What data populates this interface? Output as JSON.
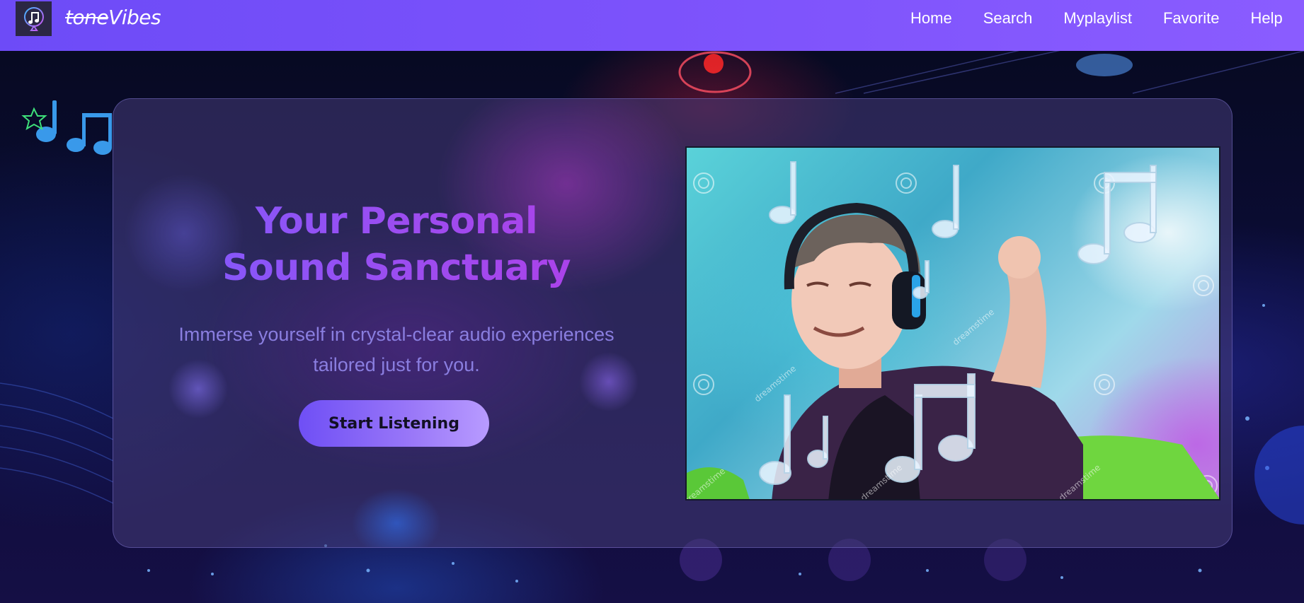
{
  "brand": {
    "strike": "tone",
    "rest": "Vibes"
  },
  "nav": {
    "items": [
      "Home",
      "Search",
      "Myplaylist",
      "Favorite",
      "Help"
    ]
  },
  "hero": {
    "title_line1": "Your Personal",
    "title_line2": "Sound Sanctuary",
    "subtitle_line1": "Immerse yourself in crystal-clear audio experiences",
    "subtitle_line2": "tailored just for you.",
    "cta_label": "Start Listening",
    "image_watermark": "dreamstime"
  },
  "colors": {
    "header": "#7c52fb",
    "title_gradient_start": "#7b5cff",
    "title_gradient_end": "#b43ce6",
    "cta": "#8a6cf8"
  },
  "icons": {
    "logo": "music-note-pin-icon"
  }
}
